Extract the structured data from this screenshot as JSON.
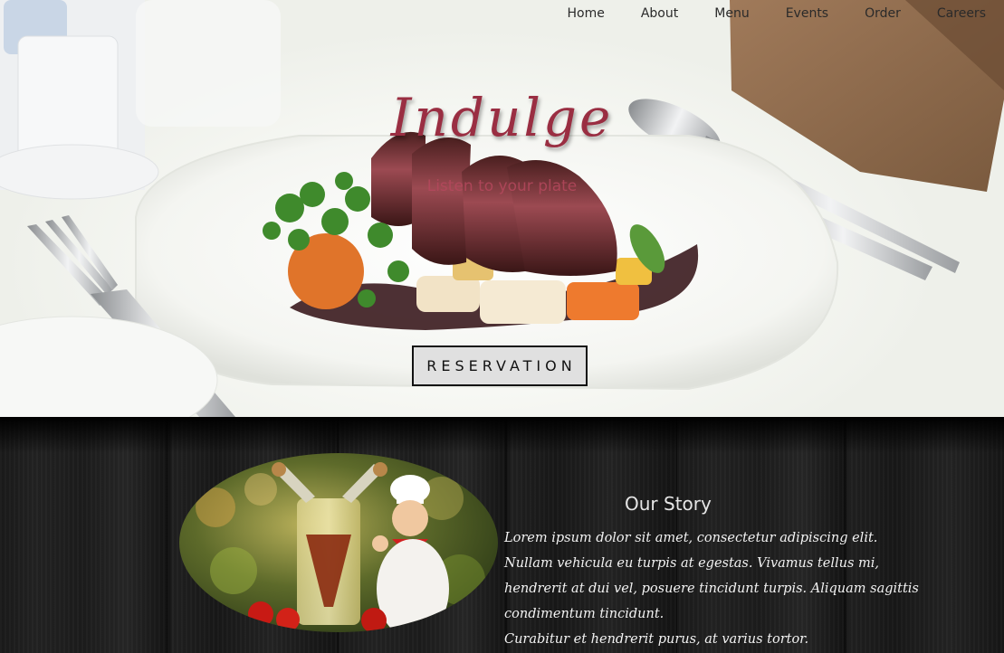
{
  "nav": {
    "items": [
      {
        "label": "Home"
      },
      {
        "label": "About"
      },
      {
        "label": "Menu"
      },
      {
        "label": "Events"
      },
      {
        "label": "Order"
      },
      {
        "label": "Careers"
      }
    ]
  },
  "hero": {
    "title": "Indulge",
    "subtitle": "Listen to your plate",
    "button_label": "RESERVATION"
  },
  "story": {
    "title": "Our Story",
    "lines": [
      "Lorem ipsum dolor sit amet, consectetur adipiscing elit.",
      "Nullam vehicula eu turpis at egestas. Vivamus tellus mi,",
      "hendrerit at dui vel, posuere tincidunt turpis. Aliquam sagittis",
      "condimentum tincidunt.",
      "Curabitur et hendrerit purus, at varius tortor."
    ]
  },
  "colors": {
    "title": "#9a2e42",
    "nav_text": "#2a2a2a",
    "button_bg": "#e0e0e0",
    "story_bg": "#1b1b1b"
  }
}
